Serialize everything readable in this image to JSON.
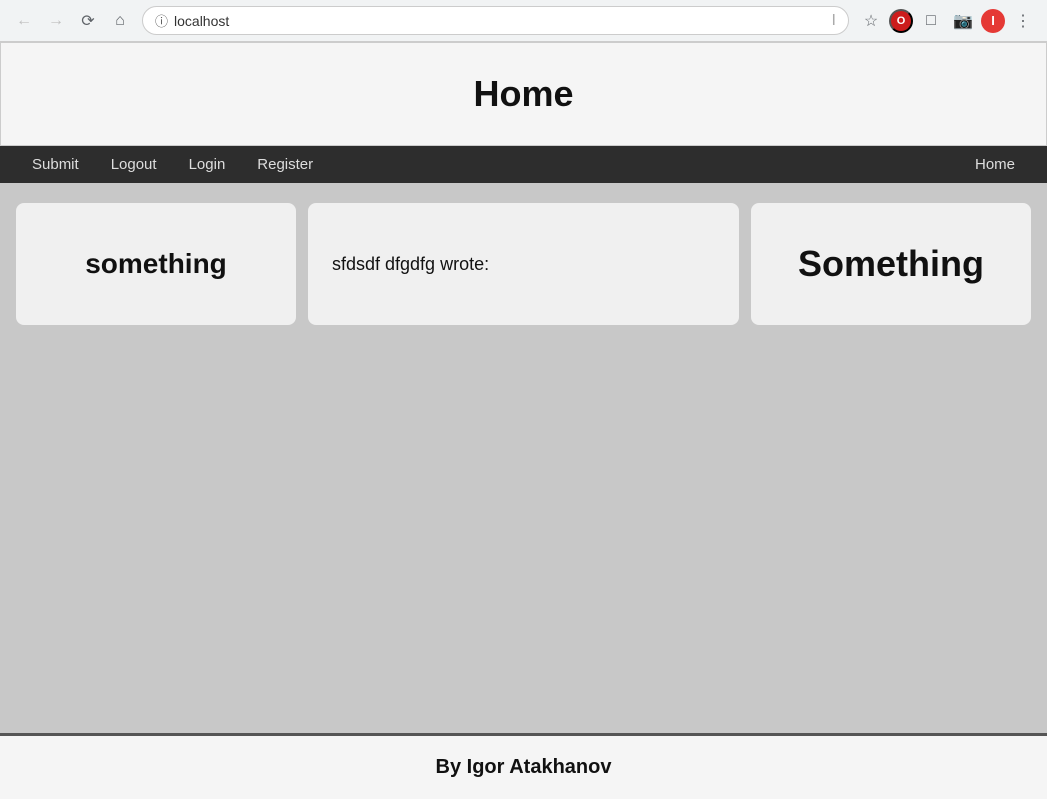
{
  "browser": {
    "url": "localhost",
    "back_label": "←",
    "forward_label": "→",
    "reload_label": "↻",
    "home_label": "⌂",
    "star_label": "☆",
    "menu_label": "⋮",
    "profile_label": "I"
  },
  "site": {
    "header": {
      "title": "Home"
    },
    "navbar": {
      "items_left": [
        {
          "label": "Submit",
          "name": "submit"
        },
        {
          "label": "Logout",
          "name": "logout"
        },
        {
          "label": "Login",
          "name": "login"
        },
        {
          "label": "Register",
          "name": "register"
        }
      ],
      "items_right": [
        {
          "label": "Home",
          "name": "home"
        }
      ]
    },
    "cards": [
      {
        "id": "card-left",
        "text": "something",
        "size": "large"
      },
      {
        "id": "card-middle",
        "text": "sfdsdf dfgdfg wrote:",
        "size": "normal"
      },
      {
        "id": "card-right",
        "text": "Something",
        "size": "large"
      }
    ],
    "footer": {
      "text": "By Igor Atakhanov"
    }
  }
}
